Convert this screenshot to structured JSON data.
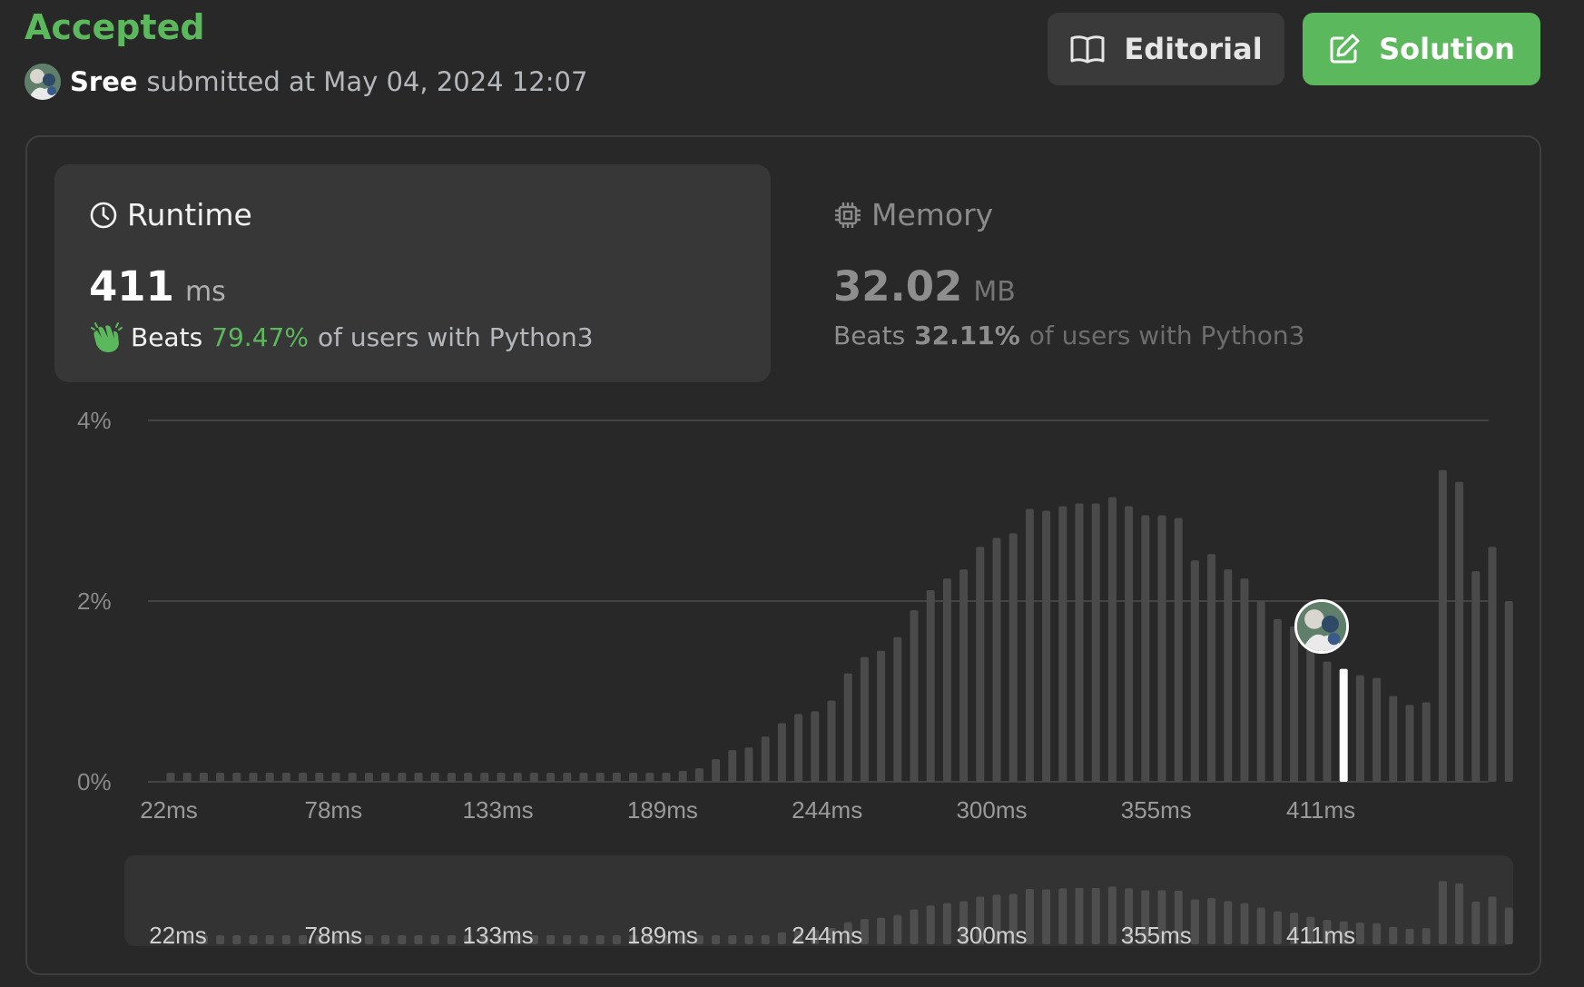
{
  "header": {
    "status": "Accepted",
    "user_name": "Sree",
    "submitted_text": "submitted at May 04, 2024 12:07",
    "editorial_label": "Editorial",
    "solution_label": "Solution"
  },
  "runtime": {
    "title": "Runtime",
    "value": "411",
    "unit": "ms",
    "beats_label": "Beats",
    "beats_pct": "79.47%",
    "beats_rest": "of users with Python3"
  },
  "memory": {
    "title": "Memory",
    "value": "32.02",
    "unit": "MB",
    "beats_label": "Beats",
    "beats_pct": "32.11%",
    "beats_rest": "of users with Python3"
  },
  "colors": {
    "accent": "#5cb85c",
    "bar": "#4a4a4a",
    "bar_selected": "#ffffff"
  },
  "chart_data": {
    "type": "bar",
    "title": "",
    "xlabel": "",
    "ylabel": "",
    "y_ticks": [
      "0%",
      "2%",
      "4%"
    ],
    "ylim": [
      0,
      4
    ],
    "x_ticks": [
      "22ms",
      "78ms",
      "133ms",
      "189ms",
      "244ms",
      "300ms",
      "355ms",
      "411ms"
    ],
    "selected_index": 71,
    "grid": true,
    "values": [
      0.1,
      0.1,
      0.1,
      0.1,
      0.1,
      0.1,
      0.1,
      0.1,
      0.1,
      0.1,
      0.1,
      0.1,
      0.1,
      0.1,
      0.1,
      0.1,
      0.1,
      0.1,
      0.1,
      0.1,
      0.1,
      0.1,
      0.1,
      0.1,
      0.1,
      0.1,
      0.1,
      0.1,
      0.1,
      0.1,
      0.1,
      0.12,
      0.15,
      0.25,
      0.35,
      0.38,
      0.5,
      0.65,
      0.75,
      0.78,
      0.9,
      1.2,
      1.38,
      1.45,
      1.6,
      1.9,
      2.12,
      2.25,
      2.35,
      2.6,
      2.7,
      2.75,
      3.02,
      3.0,
      3.05,
      3.08,
      3.08,
      3.15,
      3.05,
      2.95,
      2.95,
      2.92,
      2.45,
      2.52,
      2.35,
      2.25,
      2.0,
      1.8,
      1.72,
      1.5,
      1.33,
      1.25,
      1.18,
      1.15,
      0.95,
      0.85,
      0.88,
      3.45,
      3.32,
      2.33,
      2.6,
      2.0
    ]
  }
}
